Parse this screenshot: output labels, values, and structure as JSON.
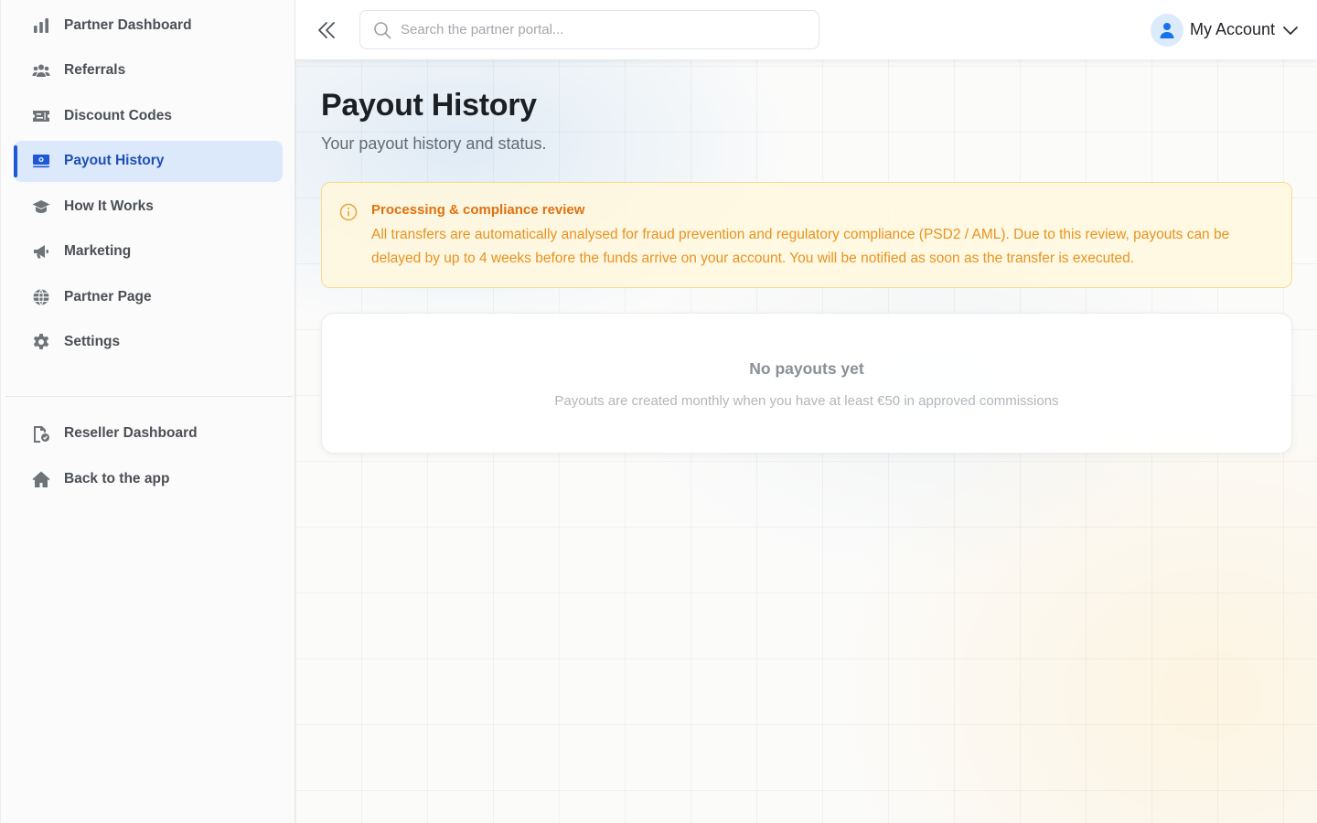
{
  "sidebar": {
    "items": [
      {
        "label": "Partner Dashboard",
        "icon": "bar-chart-icon"
      },
      {
        "label": "Referrals",
        "icon": "users-icon"
      },
      {
        "label": "Discount Codes",
        "icon": "ticket-icon"
      },
      {
        "label": "Payout History",
        "icon": "money-bill-icon",
        "active": true
      },
      {
        "label": "How It Works",
        "icon": "graduation-cap-icon"
      },
      {
        "label": "Marketing",
        "icon": "megaphone-icon"
      },
      {
        "label": "Partner Page",
        "icon": "globe-icon"
      },
      {
        "label": "Settings",
        "icon": "gear-icon"
      }
    ],
    "secondary_items": [
      {
        "label": "Reseller Dashboard",
        "icon": "reseller-icon"
      },
      {
        "label": "Back to the app",
        "icon": "home-icon"
      }
    ]
  },
  "topbar": {
    "search_placeholder": "Search the partner portal...",
    "account_label": "My Account"
  },
  "page": {
    "title": "Payout History",
    "subtitle": "Your payout history and status."
  },
  "alert": {
    "title": "Processing & compliance review",
    "body": "All transfers are automatically analysed for fraud prevention and regulatory compliance (PSD2 / AML). Due to this review, payouts can be delayed by up to 4 weeks before the funds arrive on your account. You will be notified as soon as the transfer is executed."
  },
  "empty_state": {
    "title": "No payouts yet",
    "text": "Payouts are created monthly when you have at least €50 in approved commissions"
  },
  "colors": {
    "accent": "#1d58d8",
    "active_bg": "#dce9fb",
    "warning_text": "#e79320",
    "warning_title": "#e0710f",
    "warning_bg": "#fff7de",
    "warning_border": "#f6dc8f"
  }
}
